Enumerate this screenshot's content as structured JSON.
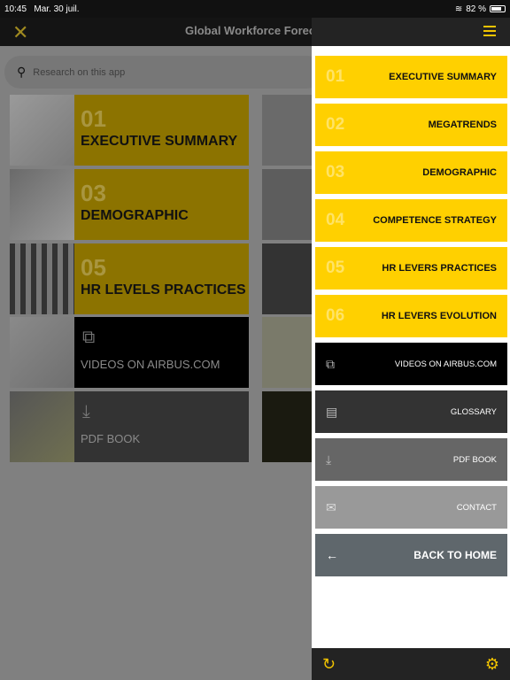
{
  "status": {
    "time": "10:45",
    "date": "Mar. 30 juil.",
    "battery": "82 %",
    "battery_level": 0.82
  },
  "header": {
    "title": "Global Workforce Foreca"
  },
  "search": {
    "placeholder": "Research on this app"
  },
  "tiles": [
    {
      "num": "01",
      "label": "EXECUTIVE SUMMARY",
      "type": "section"
    },
    {
      "num": "03",
      "label": "DEMOGRAPHIC",
      "type": "section"
    },
    {
      "num": "05",
      "label": "HR LEVELS PRACTICES",
      "type": "section"
    },
    {
      "label": "VIDEOS ON AIRBUS.COM",
      "icon": "video-library-icon",
      "type": "link"
    },
    {
      "label": "PDF BOOK",
      "icon": "download-icon",
      "type": "link"
    }
  ],
  "menu": {
    "items": [
      {
        "num": "01",
        "label": "EXECUTIVE SUMMARY"
      },
      {
        "num": "02",
        "label": "MEGATRENDS"
      },
      {
        "num": "03",
        "label": "DEMOGRAPHIC"
      },
      {
        "num": "04",
        "label": "COMPETENCE STRATEGY"
      },
      {
        "num": "05",
        "label": "HR LEVERS PRACTICES"
      },
      {
        "num": "06",
        "label": "HR LEVERS EVOLUTION"
      }
    ],
    "links": [
      {
        "label": "VIDEOS ON AIRBUS.COM",
        "icon": "video-library-icon",
        "color": "#000000"
      },
      {
        "label": "GLOSSARY",
        "icon": "glossary-icon",
        "color": "#333333"
      },
      {
        "label": "PDF BOOK",
        "icon": "download-icon",
        "color": "#666666"
      },
      {
        "label": "CONTACT",
        "icon": "mail-icon",
        "color": "#999999"
      }
    ],
    "back": {
      "label": "BACK TO HOME",
      "color": "#5f676c"
    }
  },
  "colors": {
    "accent": "#FFD000",
    "dimmed_accent": "#8c7300"
  }
}
